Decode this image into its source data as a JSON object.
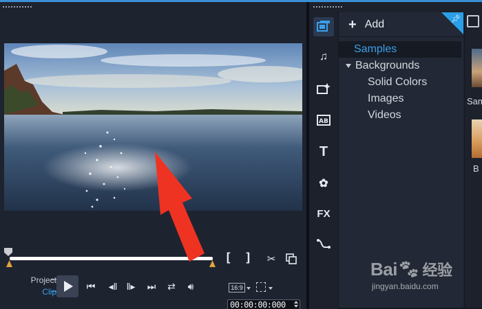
{
  "player": {
    "mode_project": "Project",
    "mode_clip": "Clip",
    "mark_in": "[",
    "mark_out": "]",
    "aspect_ratio": "16:9",
    "timecode": "00:00:00:000"
  },
  "library": {
    "add_label": "Add",
    "tree": [
      {
        "label": "Samples",
        "selected": true
      },
      {
        "label": "Backgrounds",
        "expanded": true
      },
      {
        "label": "Solid Colors"
      },
      {
        "label": "Images"
      },
      {
        "label": "Videos"
      }
    ],
    "thumb_labels": [
      "Sam",
      "B"
    ]
  },
  "watermark": {
    "logo": "Bai",
    "logo_cn": "经验",
    "url": "jingyan.baidu.com"
  },
  "colors": {
    "accent_blue": "#3aa0ea",
    "trim_orange": "#e0a53a",
    "annotation_arrow": "#ee3322"
  },
  "icons": [
    "play-icon",
    "skip-to-start-icon",
    "previous-frame-icon",
    "next-frame-icon",
    "skip-to-end-icon",
    "repeat-icon",
    "volume-icon",
    "scissors-icon",
    "copy-clip-icon",
    "media-library-icon",
    "music-icon",
    "transition-icon",
    "title-ab-icon",
    "text-t-icon",
    "graphics-icon",
    "fx-icon",
    "motion-path-icon",
    "pin-icon"
  ]
}
